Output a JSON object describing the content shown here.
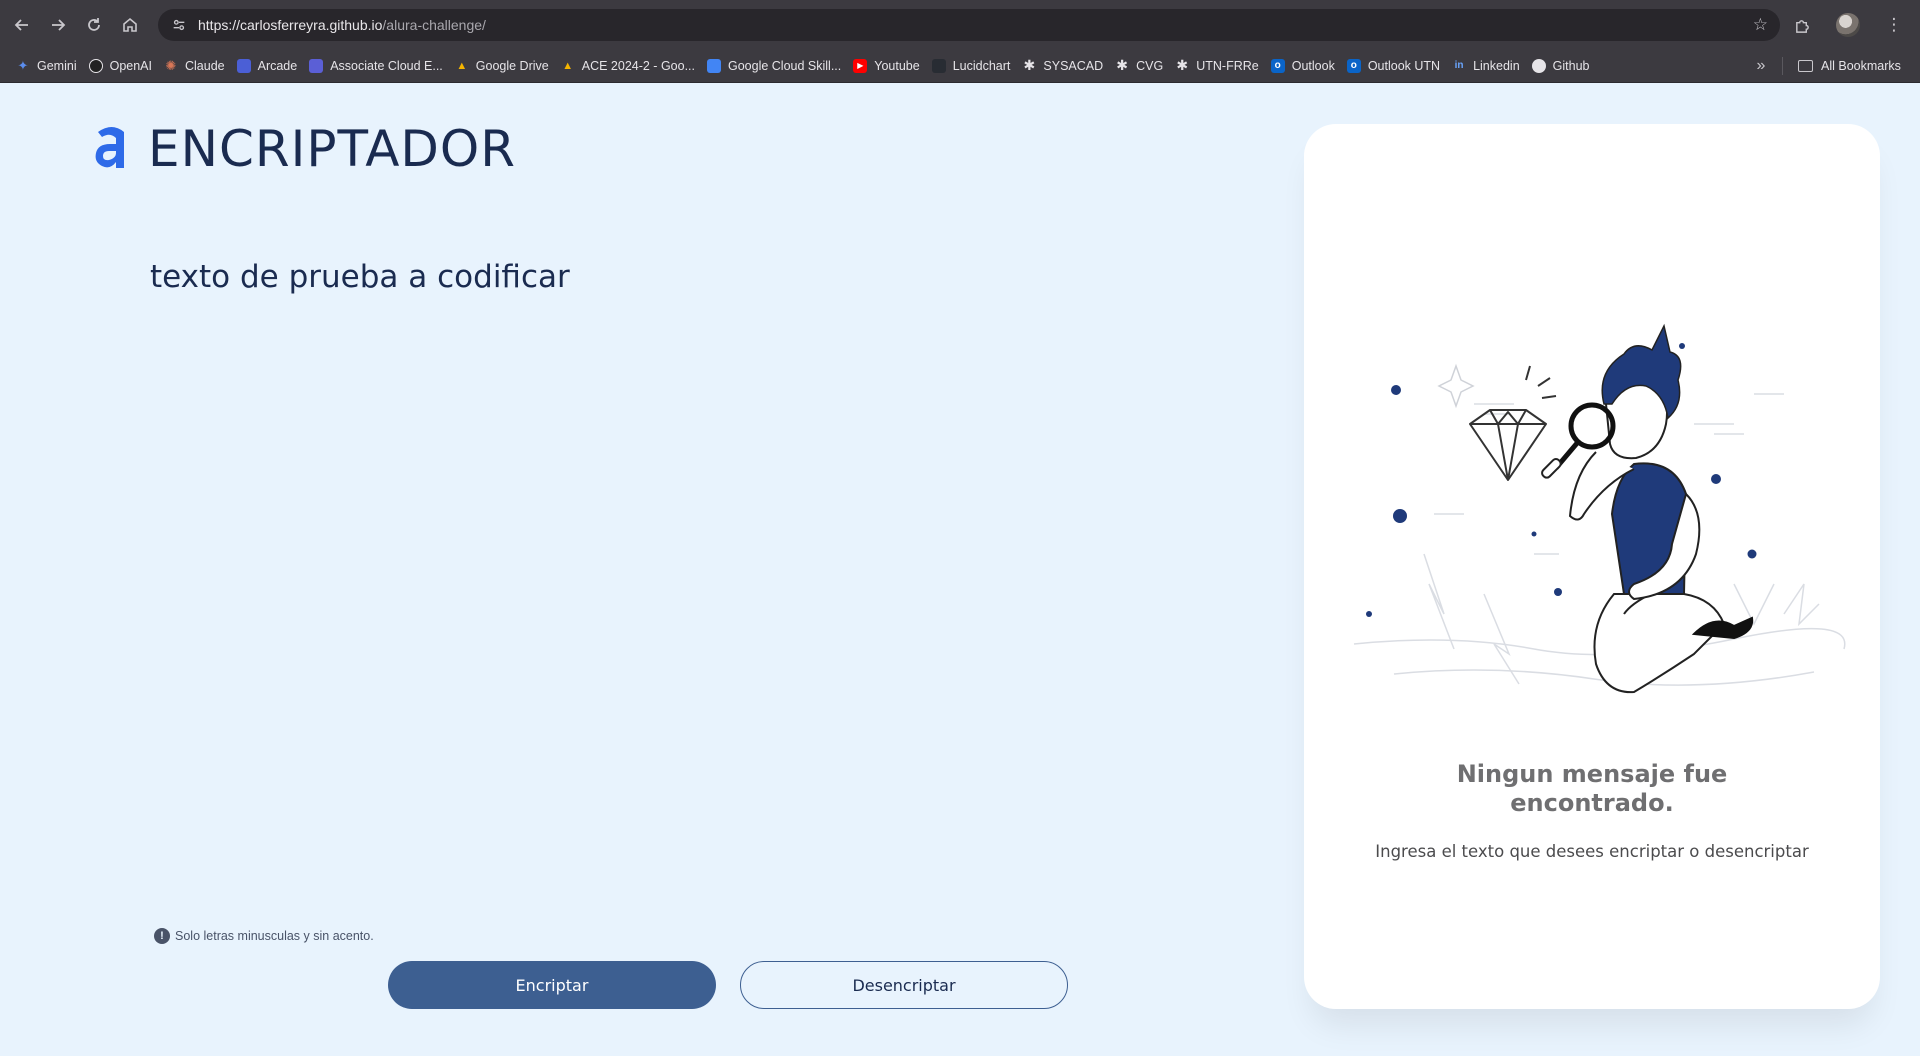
{
  "browser": {
    "url_host": "https://carlosferreyra.github.io",
    "url_path": "/alura-challenge/",
    "bookmarks": [
      {
        "label": "Gemini",
        "icon": "gemini-icon",
        "color": "#5b8dee"
      },
      {
        "label": "OpenAI",
        "icon": "openai-icon",
        "color": "#222222"
      },
      {
        "label": "Claude",
        "icon": "claude-icon",
        "color": "#d97757"
      },
      {
        "label": "Arcade",
        "icon": "arcade-icon",
        "color": "#4b5fd6"
      },
      {
        "label": "Associate Cloud E...",
        "icon": "list-icon",
        "color": "#5b5fd6"
      },
      {
        "label": "Google Drive",
        "icon": "drive-icon",
        "color": "#1fa463"
      },
      {
        "label": "ACE 2024-2 - Goo...",
        "icon": "drive-icon",
        "color": "#1fa463"
      },
      {
        "label": "Google Cloud Skill...",
        "icon": "cloud-icon",
        "color": "#4285f4"
      },
      {
        "label": "Youtube",
        "icon": "youtube-icon",
        "color": "#ff0000"
      },
      {
        "label": "Lucidchart",
        "icon": "lucidchart-icon",
        "color": "#282c33"
      },
      {
        "label": "SYSACAD",
        "icon": "utn-icon",
        "color": "#3c3a40"
      },
      {
        "label": "CVG",
        "icon": "utn-icon",
        "color": "#3c3a40"
      },
      {
        "label": "UTN-FRRe",
        "icon": "utn-icon",
        "color": "#3c3a40"
      },
      {
        "label": "Outlook",
        "icon": "outlook-icon",
        "color": "#0a64c8"
      },
      {
        "label": "Outlook UTN",
        "icon": "outlook-icon",
        "color": "#0a64c8"
      },
      {
        "label": "Linkedin",
        "icon": "linkedin-icon",
        "color": "#0a66c2"
      },
      {
        "label": "Github",
        "icon": "github-icon",
        "color": "#ffffff"
      }
    ],
    "more": "»",
    "all_bookmarks": "All Bookmarks"
  },
  "page": {
    "brand": "ENCRIPTADOR",
    "input_value": "texto de prueba a codificar",
    "hint": "Solo letras minusculas y sin acento.",
    "encrypt_label": "Encriptar",
    "decrypt_label": "Desencriptar",
    "result_title": "Ningun mensaje fue encontrado.",
    "result_subtitle": "Ingresa el texto que desees encriptar o desencriptar",
    "colors": {
      "background": "#e8f3fd",
      "primary": "#3d5f91",
      "text": "#1a2b50",
      "logo": "#2e6ae8"
    }
  }
}
